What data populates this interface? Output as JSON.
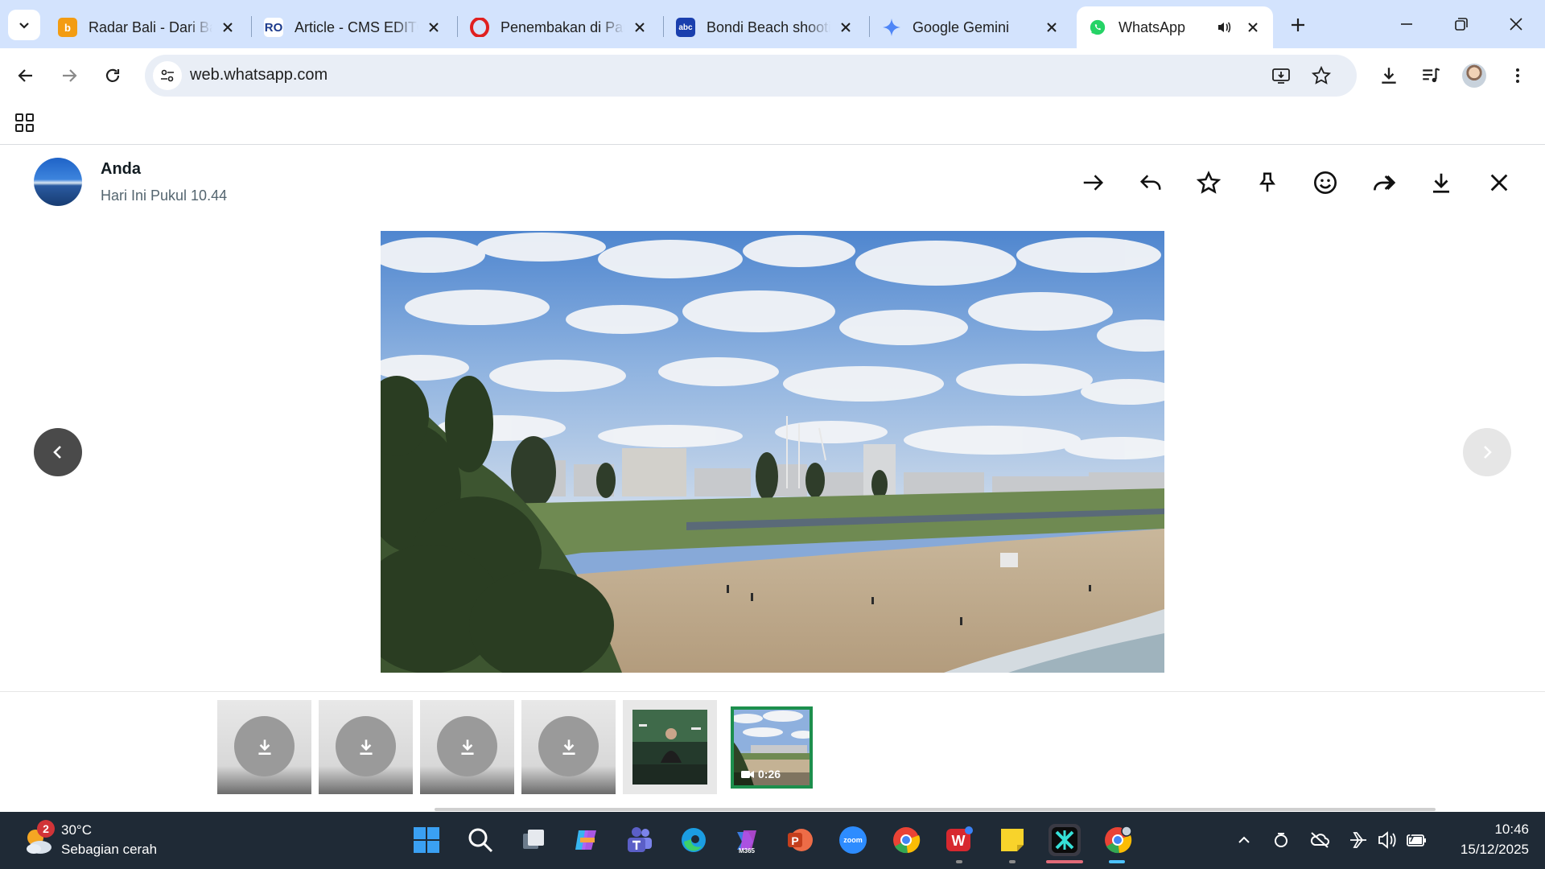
{
  "browser": {
    "tabs": [
      {
        "title": "Radar Bali - Dari Bali Untuk Indonesia",
        "favicon_color": "#f39c12",
        "favicon_letter": "b",
        "active": false
      },
      {
        "title": "Article - CMS EDITOR",
        "favicon_color": "#1b3a8c",
        "favicon_letter": "RO",
        "active": false
      },
      {
        "title": "Penembakan di Pantai Bondi",
        "favicon_color": "#e02020",
        "favicon_letter": "",
        "active": false
      },
      {
        "title": "Bondi Beach shooting",
        "favicon_color": "#1a3fae",
        "favicon_letter": "abc",
        "active": false
      },
      {
        "title": "Google Gemini",
        "favicon_color": "#4f86f7",
        "favicon_letter": "",
        "active": false
      },
      {
        "title": "WhatsApp",
        "favicon_color": "#25d366",
        "favicon_letter": "",
        "active": true
      }
    ],
    "url": "web.whatsapp.com"
  },
  "viewer": {
    "sender_name": "Anda",
    "sender_time": "Hari Ini Pukul 10.44",
    "actions": [
      "go-to-message",
      "reply",
      "star",
      "pin",
      "react",
      "forward",
      "download",
      "close"
    ],
    "video_duration": "0:26",
    "thumbnails": [
      {
        "kind": "download"
      },
      {
        "kind": "download"
      },
      {
        "kind": "download"
      },
      {
        "kind": "download"
      },
      {
        "kind": "image"
      },
      {
        "kind": "video",
        "selected": true
      }
    ]
  },
  "taskbar": {
    "weather_badge": "2",
    "weather_temp": "30°C",
    "weather_desc": "Sebagian cerah",
    "apps": [
      {
        "name": "start",
        "color": "#2b9bf4",
        "label": ""
      },
      {
        "name": "search",
        "color": "transparent",
        "label": ""
      },
      {
        "name": "task-view",
        "color": "transparent",
        "label": ""
      },
      {
        "name": "copilot",
        "color": "#7b5cff",
        "label": ""
      },
      {
        "name": "teams",
        "color": "#5b5fc7",
        "label": ""
      },
      {
        "name": "edge",
        "color": "#1b9de2",
        "label": ""
      },
      {
        "name": "m365",
        "color": "#3a7be0",
        "label": "M365"
      },
      {
        "name": "powerpoint",
        "color": "#d24726",
        "label": "P"
      },
      {
        "name": "zoom",
        "color": "#2d8cff",
        "label": "zoom"
      },
      {
        "name": "chrome",
        "color": "#34a853",
        "label": ""
      },
      {
        "name": "wps",
        "color": "#d7282f",
        "label": "W"
      },
      {
        "name": "sticky-notes",
        "color": "#f8d32b",
        "label": ""
      },
      {
        "name": "capcut",
        "color": "#111111",
        "label": ""
      },
      {
        "name": "chrome-profile",
        "color": "#34a853",
        "label": ""
      }
    ],
    "clock_time": "10:46",
    "clock_date": "15/12/2025"
  }
}
